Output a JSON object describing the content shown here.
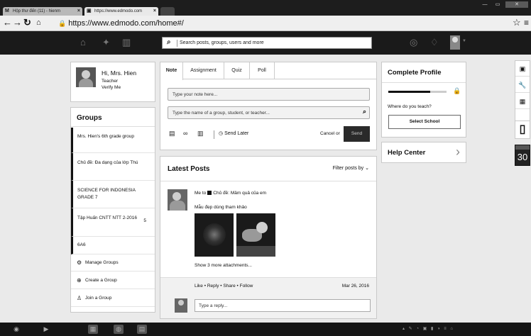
{
  "browser": {
    "tabs": [
      {
        "label": "Hộp thư đến (11) - hienm",
        "icon": "gmail-icon"
      },
      {
        "label": "https://www.edmodo.com",
        "icon": "edmodo-icon"
      }
    ],
    "url": "https://www.edmodo.com/home#/"
  },
  "topnav": {
    "search_placeholder": "Search posts, groups, users and more"
  },
  "profile": {
    "greeting": "Hi, Mrs. Hien",
    "role": "Teacher",
    "verify": "Verify Me"
  },
  "groups": {
    "title": "Groups",
    "items": [
      {
        "name": "Mrs. Hien's 6th grade group",
        "count": ""
      },
      {
        "name": "Chủ đề: Đa dạng của lớp Thú",
        "count": ""
      },
      {
        "name": "SCIENCE FOR INDONESIA GRADE 7",
        "count": ""
      },
      {
        "name": "Tập Huấn CNTT NTT 2-2016",
        "count": "5"
      },
      {
        "name": "6A6",
        "count": ""
      }
    ],
    "actions": [
      {
        "label": "Manage Groups",
        "icon": "gear-icon"
      },
      {
        "label": "Create a Group",
        "icon": "plus-circle-icon"
      },
      {
        "label": "Join a Group",
        "icon": "people-icon"
      }
    ]
  },
  "composer": {
    "tabs": [
      "Note",
      "Assignment",
      "Quiz",
      "Poll"
    ],
    "note_placeholder": "Type your note here...",
    "recipient_placeholder": "Type the name of a group, student, or teacher...",
    "send_later": "Send Later",
    "cancel_or": "Cancel or",
    "send": "Send"
  },
  "posts": {
    "title": "Latest Posts",
    "filter": "Filter posts by",
    "post": {
      "sender": "Me to",
      "recipient": "Chủ đề: Mâm quả của em",
      "body": "Mẫu đẹp dùng tham khảo",
      "show_more": "Show 3 more attachments...",
      "actions": [
        "Like",
        "Reply",
        "Share",
        "Follow"
      ],
      "date": "Mar 26, 2016"
    },
    "reply_placeholder": "Type a reply..."
  },
  "complete_profile": {
    "title": "Complete Profile",
    "progress": 0.72,
    "question": "Where do you teach?",
    "button": "Select School"
  },
  "help": {
    "title": "Help Center"
  },
  "sidebar_tools": {
    "calendar_day": "30"
  },
  "colors": {
    "topnav_bg": "#1a1a1a",
    "send_bg": "#2a2a2a",
    "page_bg": "#eaeaea"
  }
}
